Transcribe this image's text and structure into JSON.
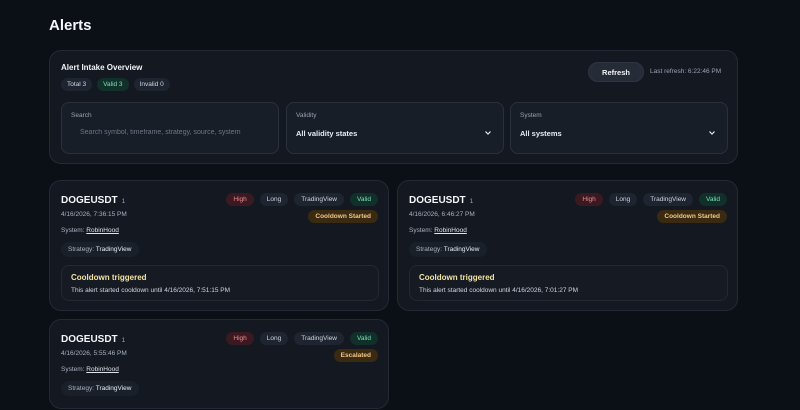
{
  "page": {
    "title": "Alerts"
  },
  "overview": {
    "title": "Alert Intake Overview",
    "pills": {
      "total": "Total 3",
      "valid": "Valid 3",
      "invalid": "Invalid 0"
    },
    "refresh_label": "Refresh",
    "last_refresh": "Last refresh: 6:22:46 PM"
  },
  "filters": {
    "search": {
      "label": "Search",
      "placeholder": "Search symbol, timeframe, strategy, source, system"
    },
    "validity": {
      "label": "Validity",
      "value": "All validity states"
    },
    "system": {
      "label": "System",
      "value": "All systems"
    }
  },
  "cards": [
    {
      "symbol": "DOGEUSDT",
      "count": "1",
      "time": "4/16/2026, 7:36:15 PM",
      "system_label": "System:",
      "system": "RobinHood",
      "strategy_label": "Strategy:",
      "strategy": "TradingView",
      "badges": {
        "priority": "High",
        "side": "Long",
        "source": "TradingView",
        "validity": "Valid"
      },
      "status": "Cooldown Started",
      "event": {
        "title": "Cooldown triggered",
        "desc": "This alert started cooldown until 4/16/2026, 7:51:15 PM"
      }
    },
    {
      "symbol": "DOGEUSDT",
      "count": "1",
      "time": "4/16/2026, 6:46:27 PM",
      "system_label": "System:",
      "system": "RobinHood",
      "strategy_label": "Strategy:",
      "strategy": "TradingView",
      "badges": {
        "priority": "High",
        "side": "Long",
        "source": "TradingView",
        "validity": "Valid"
      },
      "status": "Cooldown Started",
      "event": {
        "title": "Cooldown triggered",
        "desc": "This alert started cooldown until 4/16/2026, 7:01:27 PM"
      }
    },
    {
      "symbol": "DOGEUSDT",
      "count": "1",
      "time": "4/16/2026, 5:55:46 PM",
      "system_label": "System:",
      "system": "RobinHood",
      "strategy_label": "Strategy:",
      "strategy": "TradingView",
      "badges": {
        "priority": "High",
        "side": "Long",
        "source": "TradingView",
        "validity": "Valid"
      },
      "status": "Escalated"
    }
  ],
  "icons": {
    "dropdown": "chevron-down-icon",
    "search": "search-icon"
  }
}
